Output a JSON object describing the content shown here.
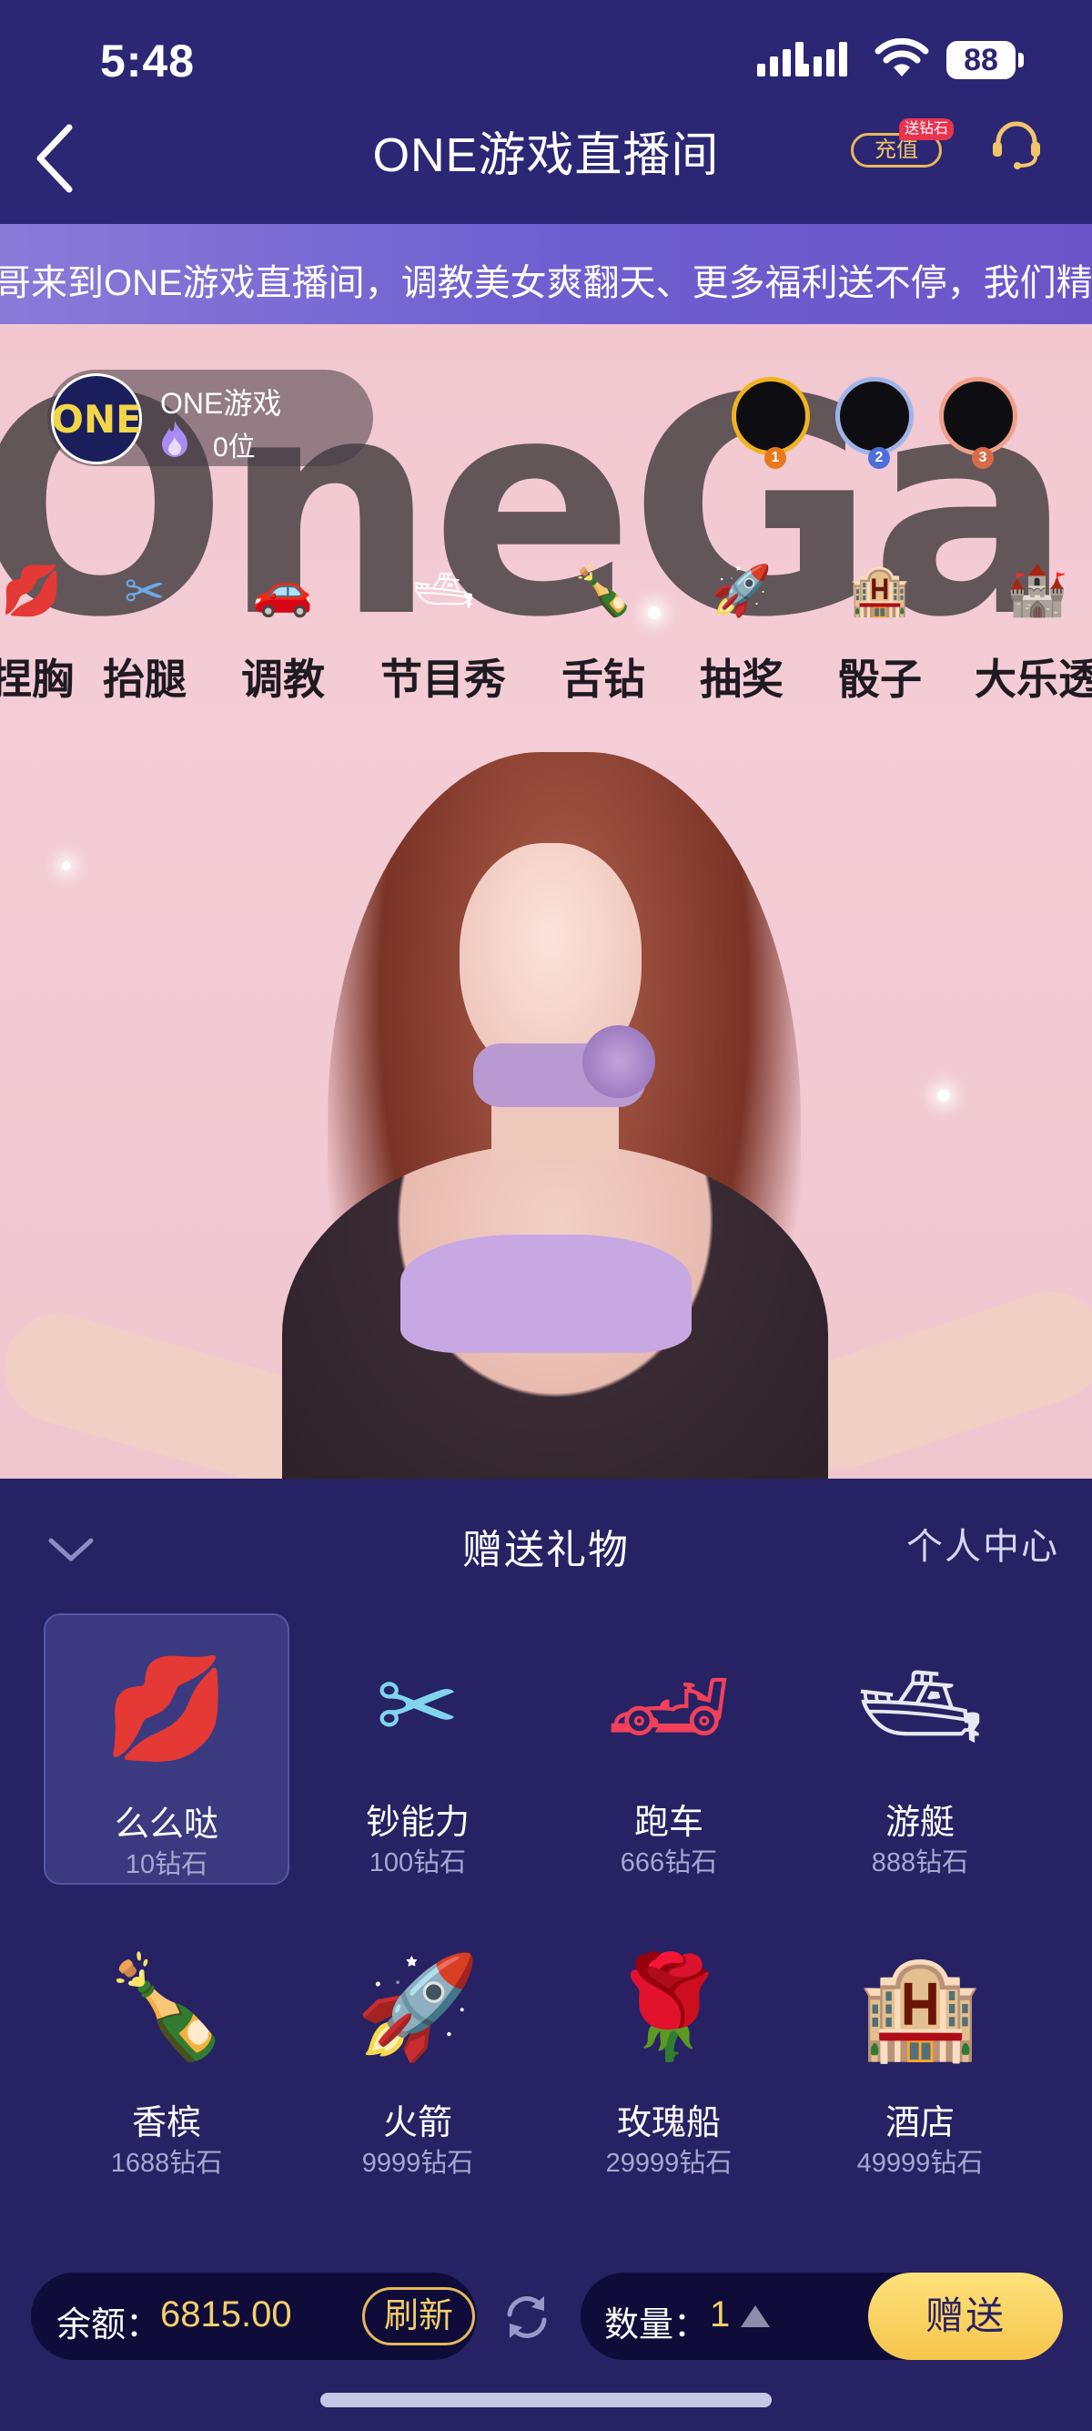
{
  "status_bar": {
    "time": "5:48",
    "battery": "88"
  },
  "nav": {
    "title": "ONE游戏直播间",
    "recharge_label": "充值",
    "recharge_tag": "送钻石"
  },
  "marquee": {
    "text": "哥来到ONE游戏直播间，调教美女爽翻天、更多福利送不停，我们精彩不"
  },
  "stream": {
    "background_word": "OneGame",
    "host": {
      "name": "ONE游戏",
      "fans": "0位",
      "avatar_text": "ONE"
    },
    "ranks": [
      {
        "badge": "1",
        "color": "#f0b21e",
        "badge_color": "#e8781e"
      },
      {
        "badge": "2",
        "color": "#9fb4ea",
        "badge_color": "#4e6fd8"
      },
      {
        "badge": "3",
        "color": "#f0a08a",
        "badge_color": "#d96a46"
      }
    ],
    "menu": [
      {
        "label": "捏胸",
        "icon": "kiss-lips-icon",
        "glyph": "💋"
      },
      {
        "label": "抬腿",
        "icon": "scissor-gift-icon",
        "glyph": "✂"
      },
      {
        "label": "调教",
        "icon": "love-car-icon",
        "glyph": "🚗"
      },
      {
        "label": "节目秀",
        "icon": "yacht-icon",
        "glyph": "🛥"
      },
      {
        "label": "舌钻",
        "icon": "champagne-icon",
        "glyph": "🍾"
      },
      {
        "label": "抽奖",
        "icon": "rocket-icon",
        "glyph": "🚀"
      },
      {
        "label": "骰子",
        "icon": "hotel-icon",
        "glyph": "🏨"
      },
      {
        "label": "大乐透",
        "icon": "castle-icon",
        "glyph": "🏰"
      }
    ]
  },
  "panel": {
    "title": "赠送礼物",
    "personal_center": "个人中心",
    "gifts": [
      {
        "name": "么么哒",
        "price": "10钻石",
        "icon": "kiss-lips-icon",
        "glyph": "💋",
        "selected": true
      },
      {
        "name": "钞能力",
        "price": "100钻石",
        "icon": "scissor-gift-icon",
        "glyph": "✂"
      },
      {
        "name": "跑车",
        "price": "666钻石",
        "icon": "love-car-icon",
        "glyph": "🏎"
      },
      {
        "name": "游艇",
        "price": "888钻石",
        "icon": "yacht-icon",
        "glyph": "🛥"
      },
      {
        "name": "香槟",
        "price": "1688钻石",
        "icon": "champagne-icon",
        "glyph": "🍾"
      },
      {
        "name": "火箭",
        "price": "9999钻石",
        "icon": "rocket-icon",
        "glyph": "🚀"
      },
      {
        "name": "玫瑰船",
        "price": "29999钻石",
        "icon": "rose-boat-icon",
        "glyph": "🌹"
      },
      {
        "name": "酒店",
        "price": "49999钻石",
        "icon": "hotel-icon",
        "glyph": "🏨"
      }
    ]
  },
  "bottom": {
    "balance_label": "余额：",
    "balance_value": "6815.00",
    "refresh_label": "刷新",
    "quantity_label": "数量：",
    "quantity_value": "1",
    "send_label": "赠送"
  },
  "colors": {
    "accent_gold": "#f3cf6a",
    "panel_bg": "#262264",
    "marquee": "#7a6ad4"
  }
}
